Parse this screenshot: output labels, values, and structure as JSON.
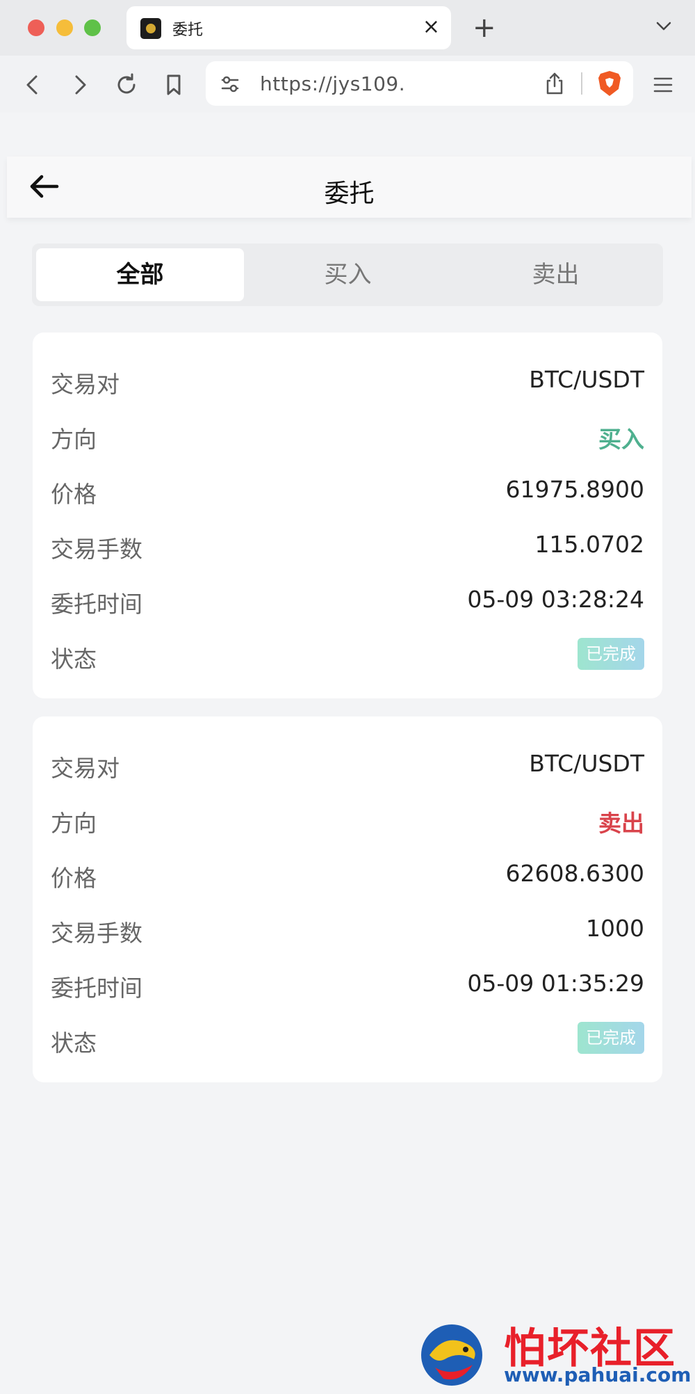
{
  "browser": {
    "tab_title": "委托",
    "tab_close": "×",
    "new_tab": "+",
    "url": "https://jys109."
  },
  "header": {
    "title": "委托"
  },
  "tabs": [
    {
      "label": "全部",
      "active": true
    },
    {
      "label": "买入",
      "active": false
    },
    {
      "label": "卖出",
      "active": false
    }
  ],
  "orders": [
    {
      "pair_label": "交易对",
      "pair": "BTC/USDT",
      "direction_label": "方向",
      "direction": "买入",
      "price_label": "价格",
      "price": "61975.8900",
      "lots_label": "交易手数",
      "lots": "115.0702",
      "time_label": "委托时间",
      "time": "05-09 03:28:24",
      "status_label": "状态",
      "status": "已完成"
    },
    {
      "pair_label": "交易对",
      "pair": "BTC/USDT",
      "direction_label": "方向",
      "direction": "卖出",
      "price_label": "价格",
      "price": "62608.6300",
      "lots_label": "交易手数",
      "lots": "1000",
      "time_label": "委托时间",
      "time": "05-09 01:35:29",
      "status_label": "状态",
      "status": "已完成"
    }
  ],
  "colors": {
    "buy": "#4fb08f",
    "sell": "#d9434b",
    "status_badge": "#9ee5cf"
  },
  "watermark": {
    "title": "怕坏社区",
    "url": "www.pahuai.com"
  }
}
